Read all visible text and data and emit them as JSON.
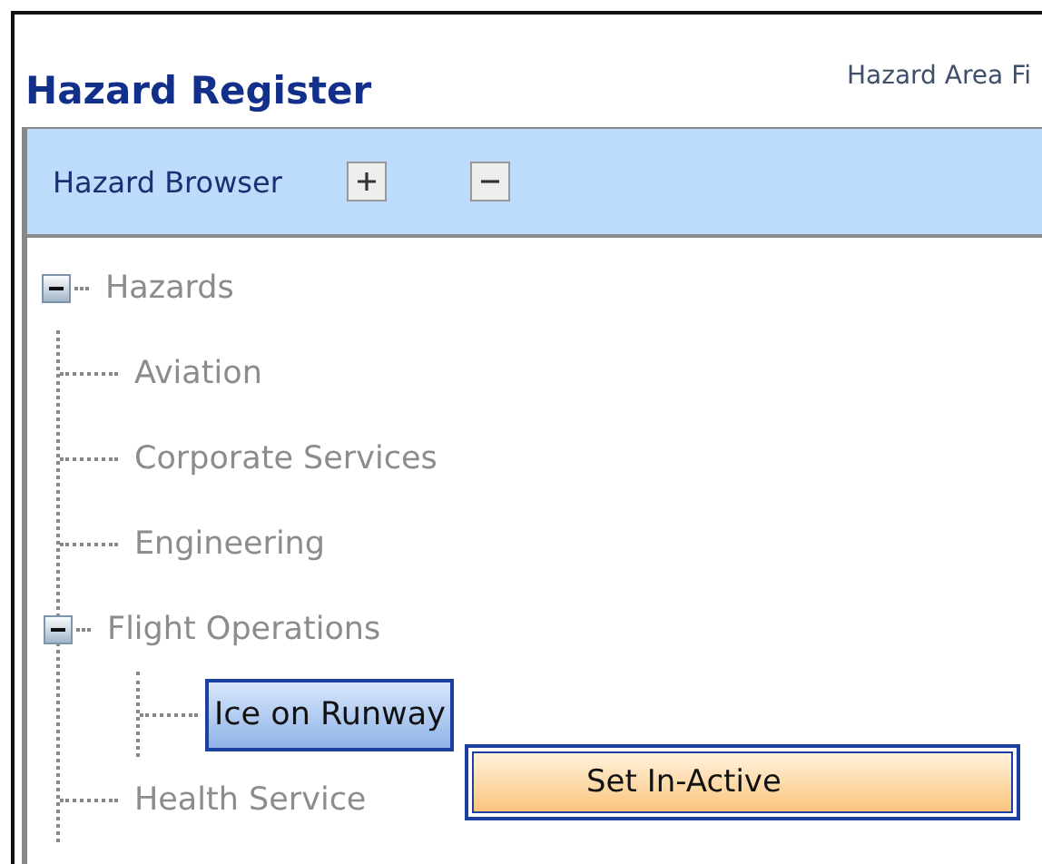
{
  "page": {
    "title": "Hazard Register",
    "filter_label": "Hazard Area Fi"
  },
  "panel": {
    "title": "Hazard Browser"
  },
  "tree": [
    {
      "label": "Hazards",
      "expanded": true,
      "selected": false,
      "children": [
        {
          "label": "Aviation",
          "selected": false
        },
        {
          "label": "Corporate Services",
          "selected": false
        },
        {
          "label": "Engineering",
          "selected": false
        },
        {
          "label": "Flight Operations",
          "expanded": true,
          "selected": false,
          "children": [
            {
              "label": "Ice on Runway",
              "selected": true
            }
          ]
        },
        {
          "label": "Health Service",
          "selected": false
        }
      ]
    }
  ],
  "context_menu": {
    "items": [
      {
        "label": "Set In-Active",
        "selected": true
      }
    ]
  }
}
